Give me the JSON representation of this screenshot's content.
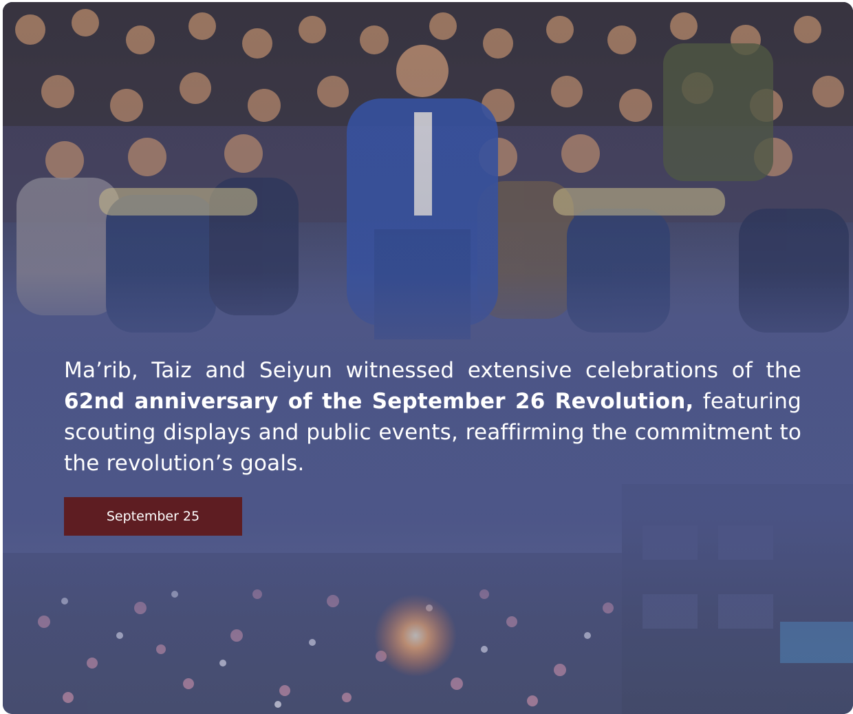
{
  "article": {
    "intro": "Ma’rib, Taiz and Seiyun witnessed extensive celebrations of the ",
    "highlight": "62nd anniversary of the September 26 Revolution,",
    "outro": " featuring scouting displays and public events, reaffirming the commitment to the revolution’s goals."
  },
  "date_badge": {
    "label": "September 25"
  },
  "colors": {
    "overlay": "#4b5486",
    "badge": "#5e1d22",
    "text": "#ffffff"
  }
}
